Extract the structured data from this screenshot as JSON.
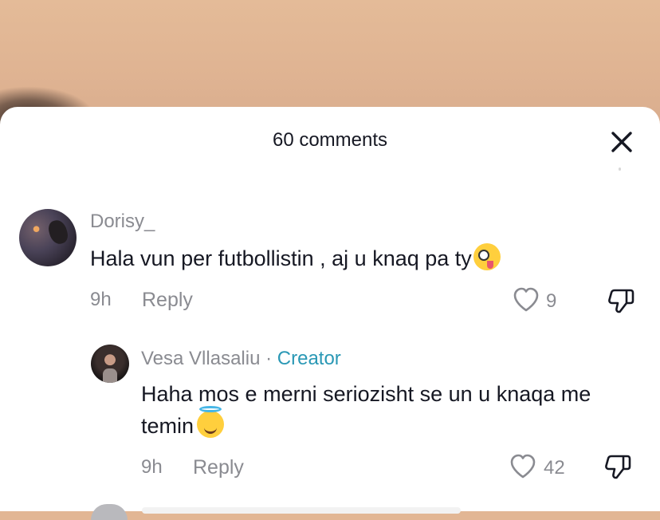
{
  "header": {
    "title": "60 comments"
  },
  "comments": [
    {
      "username": "Dorisy_",
      "text": "Hala vun per futbollistin , aj u knaq pa ty",
      "emoji": "zany-face",
      "time": "9h",
      "reply_label": "Reply",
      "likes": "9"
    }
  ],
  "replies": [
    {
      "username": "Vesa Vllasaliu",
      "separator": " · ",
      "badge": "Creator",
      "text": "Haha mos e merni seriozisht se un u knaqa me temin",
      "emoji": "smiling-face-with-halo",
      "time": "9h",
      "reply_label": "Reply",
      "likes": "42"
    }
  ],
  "colors": {
    "creator": "#2a98b5",
    "secondary_text": "#8a8b91",
    "primary_text": "#161823"
  }
}
